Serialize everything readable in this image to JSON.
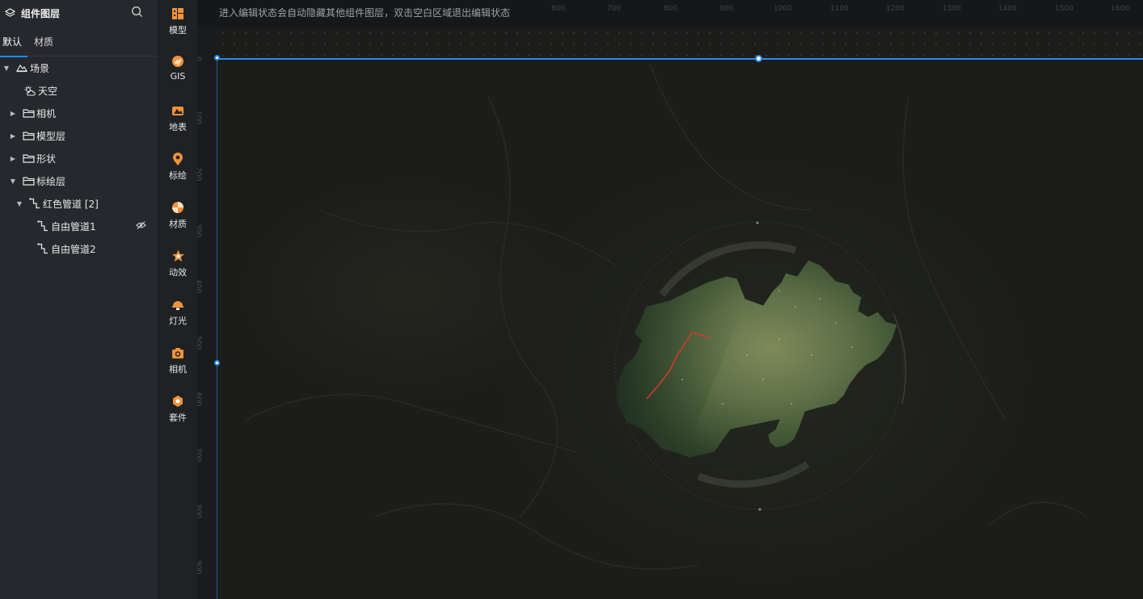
{
  "layer_panel": {
    "title": "组件图层",
    "tabs": [
      {
        "label": "默认",
        "active": true
      },
      {
        "label": "材质",
        "active": false
      }
    ],
    "tree": [
      {
        "label": "场景",
        "icon": "mountain-icon",
        "expanded": true
      },
      {
        "label": "天空",
        "icon": "weather-cloud-sun-icon"
      },
      {
        "label": "相机",
        "icon": "folder-icon",
        "expanded": false
      },
      {
        "label": "模型层",
        "icon": "folder-icon",
        "expanded": false
      },
      {
        "label": "形状",
        "icon": "folder-icon",
        "expanded": false
      },
      {
        "label": "标绘层",
        "icon": "folder-icon",
        "expanded": true
      },
      {
        "label": "红色管道 [2]",
        "icon": "pipeline-icon",
        "expanded": true
      },
      {
        "label": "自由管道1",
        "icon": "pipeline-icon",
        "hidden": true
      },
      {
        "label": "自由管道2",
        "icon": "pipeline-icon"
      }
    ]
  },
  "component_bar": {
    "items": [
      {
        "label": "模型",
        "icon": "model-icon"
      },
      {
        "label": "GIS",
        "icon": "gis-icon"
      },
      {
        "label": "地表",
        "icon": "terrain-icon"
      },
      {
        "label": "标绘",
        "icon": "location-pin-icon"
      },
      {
        "label": "材质",
        "icon": "material-icon"
      },
      {
        "label": "动效",
        "icon": "effect-star-icon"
      },
      {
        "label": "灯光",
        "icon": "light-icon"
      },
      {
        "label": "相机",
        "icon": "camera-icon"
      },
      {
        "label": "套件",
        "icon": "kit-icon"
      }
    ]
  },
  "canvas": {
    "notice": "进入编辑状态会自动隐藏其他组件图层，双击空白区域退出编辑状态",
    "ruler_top": [
      "600",
      "700",
      "800",
      "900",
      "1000",
      "1100",
      "1200",
      "1300",
      "1400",
      "1500",
      "1600"
    ],
    "ruler_left": [
      "0",
      "100",
      "200",
      "300",
      "400",
      "500",
      "600",
      "700",
      "800",
      "900"
    ]
  },
  "colors": {
    "accent_blue": "#1f8df0",
    "icon_orange": "#f0923a",
    "pipeline_red": "#d23a2a"
  }
}
